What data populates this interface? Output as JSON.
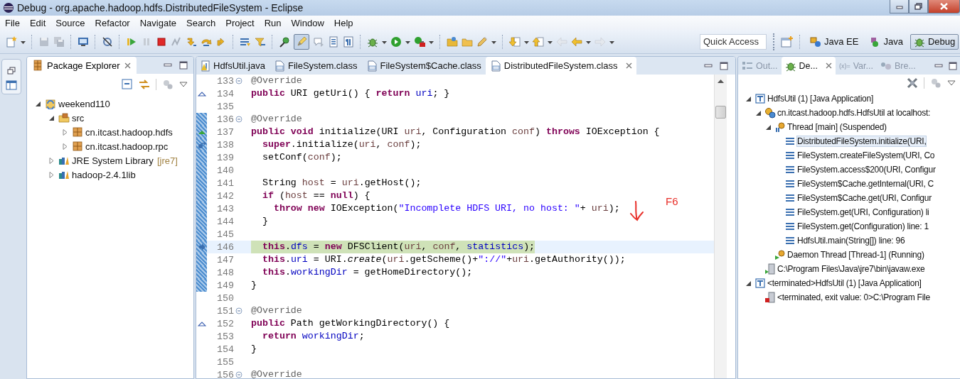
{
  "window": {
    "title": "Debug - org.apache.hadoop.hdfs.DistributedFileSystem - Eclipse"
  },
  "menu": [
    "File",
    "Edit",
    "Source",
    "Refactor",
    "Navigate",
    "Search",
    "Project",
    "Run",
    "Window",
    "Help"
  ],
  "toolbar": {
    "highlight_toggle": {
      "pressed": true
    },
    "quick_access": {
      "placeholder": "Quick Access"
    },
    "perspectives": [
      {
        "label": "Java EE",
        "selected": false
      },
      {
        "label": "Java",
        "selected": false
      },
      {
        "label": "Debug",
        "selected": true
      }
    ]
  },
  "package_explorer": {
    "title": "Package Explorer",
    "tree": [
      {
        "label": "weekend110",
        "kind": "project",
        "expanded": true,
        "children": [
          {
            "label": "src",
            "kind": "source-folder",
            "expanded": true,
            "children": [
              {
                "label": "cn.itcast.hadoop.hdfs",
                "kind": "package",
                "expanded": false
              },
              {
                "label": "cn.itcast.hadoop.rpc",
                "kind": "package",
                "expanded": false
              }
            ]
          },
          {
            "label": "JRE System Library",
            "decoration": "[jre7]",
            "kind": "library",
            "expanded": false
          },
          {
            "label": "hadoop-2.4.1lib",
            "kind": "library",
            "expanded": false
          }
        ]
      }
    ]
  },
  "editor": {
    "tabs": [
      {
        "label": "HdfsUtil.java",
        "kind": "java",
        "selected": false
      },
      {
        "label": "FileSystem.class",
        "kind": "class",
        "selected": false
      },
      {
        "label": "FileSystem$Cache.class",
        "kind": "class",
        "selected": false
      },
      {
        "label": "DistributedFileSystem.class",
        "kind": "class",
        "selected": true
      }
    ],
    "lines": [
      {
        "number": "133",
        "collapsible": true,
        "in_range": false,
        "current": false,
        "tokens": [
          {
            "kind": "ann",
            "text": "@Override"
          }
        ]
      },
      {
        "number": "134",
        "collapsible": false,
        "in_range": false,
        "current": false,
        "marker": {
          "kind": "override"
        },
        "tokens": [
          {
            "kind": "kw",
            "text": "public"
          },
          {
            "kind": "t",
            "text": " URI getUri() { "
          },
          {
            "kind": "kw",
            "text": "return "
          },
          {
            "kind": "fld",
            "text": "uri"
          },
          {
            "kind": "t",
            "text": "; }"
          }
        ]
      },
      {
        "number": "135",
        "collapsible": false,
        "in_range": false,
        "current": false
      },
      {
        "number": "136",
        "collapsible": true,
        "in_range": true,
        "current": false,
        "tokens": [
          {
            "kind": "ann",
            "text": "@Override"
          }
        ]
      },
      {
        "number": "137",
        "collapsible": false,
        "in_range": true,
        "current": false,
        "marker": {
          "kind": "implements"
        },
        "tokens": [
          {
            "kind": "kw",
            "text": "public void"
          },
          {
            "kind": "t",
            "text": " initialize(URI "
          },
          {
            "kind": "var",
            "text": "uri"
          },
          {
            "kind": "t",
            "text": ", Configuration "
          },
          {
            "kind": "var",
            "text": "conf"
          },
          {
            "kind": "t",
            "text": ") "
          },
          {
            "kind": "kw",
            "text": "throws"
          },
          {
            "kind": "t",
            "text": " IOException {"
          }
        ]
      },
      {
        "number": "138",
        "collapsible": false,
        "in_range": true,
        "current": false,
        "marker": {
          "kind": "step"
        },
        "tokens": [
          {
            "kind": "kw",
            "text": "  super"
          },
          {
            "kind": "t",
            "text": ".initialize("
          },
          {
            "kind": "var",
            "text": "uri"
          },
          {
            "kind": "t",
            "text": ", "
          },
          {
            "kind": "var",
            "text": "conf"
          },
          {
            "kind": "t",
            "text": ");"
          }
        ]
      },
      {
        "number": "139",
        "collapsible": false,
        "in_range": true,
        "current": false,
        "tokens": [
          {
            "kind": "t",
            "text": "  setConf("
          },
          {
            "kind": "var",
            "text": "conf"
          },
          {
            "kind": "t",
            "text": ");"
          }
        ]
      },
      {
        "number": "140",
        "collapsible": false,
        "in_range": true,
        "current": false
      },
      {
        "number": "141",
        "collapsible": false,
        "in_range": true,
        "current": false,
        "tokens": [
          {
            "kind": "t",
            "text": "  String "
          },
          {
            "kind": "var",
            "text": "host"
          },
          {
            "kind": "t",
            "text": " = "
          },
          {
            "kind": "var",
            "text": "uri"
          },
          {
            "kind": "t",
            "text": ".getHost();"
          }
        ]
      },
      {
        "number": "142",
        "collapsible": false,
        "in_range": true,
        "current": false,
        "tokens": [
          {
            "kind": "kw",
            "text": "  if"
          },
          {
            "kind": "t",
            "text": " ("
          },
          {
            "kind": "var",
            "text": "host"
          },
          {
            "kind": "t",
            "text": " == "
          },
          {
            "kind": "kw",
            "text": "null"
          },
          {
            "kind": "t",
            "text": ") {"
          }
        ]
      },
      {
        "number": "143",
        "collapsible": false,
        "in_range": true,
        "current": false,
        "tokens": [
          {
            "kind": "kw",
            "text": "    throw new"
          },
          {
            "kind": "t",
            "text": " IOException("
          },
          {
            "kind": "str",
            "text": "\"Incomplete HDFS URI, no host: \""
          },
          {
            "kind": "t",
            "text": "+ "
          },
          {
            "kind": "var",
            "text": "uri"
          },
          {
            "kind": "t",
            "text": ");"
          }
        ]
      },
      {
        "number": "144",
        "collapsible": false,
        "in_range": true,
        "current": false,
        "tokens": [
          {
            "kind": "t",
            "text": "  }"
          }
        ]
      },
      {
        "number": "145",
        "collapsible": false,
        "in_range": true,
        "current": false
      },
      {
        "number": "146",
        "collapsible": false,
        "in_range": true,
        "current": true,
        "tokens": [
          {
            "kind": "kw",
            "text": "  this"
          },
          {
            "kind": "t",
            "text": "."
          },
          {
            "kind": "fld",
            "text": "dfs"
          },
          {
            "kind": "t",
            "text": " = "
          },
          {
            "kind": "kw",
            "text": "new"
          },
          {
            "kind": "t",
            "text": " DFSClient("
          },
          {
            "kind": "var",
            "text": "uri"
          },
          {
            "kind": "t",
            "text": ", "
          },
          {
            "kind": "var",
            "text": "conf"
          },
          {
            "kind": "t",
            "text": ", "
          },
          {
            "kind": "fld",
            "text": "statistics"
          },
          {
            "kind": "t",
            "text": ");"
          }
        ]
      },
      {
        "number": "147",
        "collapsible": false,
        "in_range": true,
        "current": false,
        "tokens": [
          {
            "kind": "kw",
            "text": "  this"
          },
          {
            "kind": "t",
            "text": "."
          },
          {
            "kind": "fld",
            "text": "uri"
          },
          {
            "kind": "t",
            "text": " = URI."
          },
          {
            "kind": "it",
            "text": "create"
          },
          {
            "kind": "t",
            "text": "("
          },
          {
            "kind": "var",
            "text": "uri"
          },
          {
            "kind": "t",
            "text": ".getScheme()+"
          },
          {
            "kind": "str",
            "text": "\"://\""
          },
          {
            "kind": "t",
            "text": "+"
          },
          {
            "kind": "var",
            "text": "uri"
          },
          {
            "kind": "t",
            "text": ".getAuthority());"
          }
        ]
      },
      {
        "number": "148",
        "collapsible": false,
        "in_range": true,
        "current": false,
        "tokens": [
          {
            "kind": "kw",
            "text": "  this"
          },
          {
            "kind": "t",
            "text": "."
          },
          {
            "kind": "fld",
            "text": "workingDir"
          },
          {
            "kind": "t",
            "text": " = getHomeDirectory();"
          }
        ]
      },
      {
        "number": "149",
        "collapsible": false,
        "in_range": true,
        "current": false,
        "tokens": [
          {
            "kind": "t",
            "text": "}"
          }
        ]
      },
      {
        "number": "150",
        "collapsible": false,
        "in_range": false,
        "current": false
      },
      {
        "number": "151",
        "collapsible": true,
        "in_range": false,
        "current": false,
        "tokens": [
          {
            "kind": "ann",
            "text": "@Override"
          }
        ]
      },
      {
        "number": "152",
        "collapsible": false,
        "in_range": false,
        "current": false,
        "marker": {
          "kind": "override"
        },
        "tokens": [
          {
            "kind": "kw",
            "text": "public"
          },
          {
            "kind": "t",
            "text": " Path getWorkingDirectory() {"
          }
        ]
      },
      {
        "number": "153",
        "collapsible": false,
        "in_range": false,
        "current": false,
        "tokens": [
          {
            "kind": "kw",
            "text": "  return "
          },
          {
            "kind": "fld",
            "text": "workingDir"
          },
          {
            "kind": "t",
            "text": ";"
          }
        ]
      },
      {
        "number": "154",
        "collapsible": false,
        "in_range": false,
        "current": false,
        "tokens": [
          {
            "kind": "t",
            "text": "}"
          }
        ]
      },
      {
        "number": "155",
        "collapsible": false,
        "in_range": false,
        "current": false
      },
      {
        "number": "156",
        "collapsible": true,
        "in_range": false,
        "current": false,
        "tokens": [
          {
            "kind": "ann",
            "text": "@Override"
          }
        ]
      }
    ],
    "annotation": {
      "text": "F6",
      "color": "#e8302a"
    }
  },
  "debug_view": {
    "tabs": [
      {
        "label": "Out...",
        "kind": "outline",
        "selected": false
      },
      {
        "label": "De...",
        "kind": "debug",
        "selected": true
      },
      {
        "label": "Var...",
        "kind": "variables",
        "glyph": "(x)=",
        "selected": false
      },
      {
        "label": "Bre...",
        "kind": "breakpoints",
        "selected": false
      }
    ],
    "tree": [
      {
        "label": "HdfsUtil (1) [Java Application]",
        "kind": "launch",
        "expanded": true,
        "children": [
          {
            "label": "cn.itcast.hadoop.hdfs.HdfsUtil at localhost:",
            "kind": "vm",
            "expanded": true,
            "children": [
              {
                "label": "Thread [main] (Suspended)",
                "kind": "thread-suspended",
                "expanded": true,
                "children": [
                  {
                    "label": "DistributedFileSystem.initialize(URI,",
                    "kind": "frame",
                    "selected": true
                  },
                  {
                    "label": "FileSystem.createFileSystem(URI, Co",
                    "kind": "frame",
                    "selected": false
                  },
                  {
                    "label": "FileSystem.access$200(URI, Configur",
                    "kind": "frame",
                    "selected": false
                  },
                  {
                    "label": "FileSystem$Cache.getInternal(URI, C",
                    "kind": "frame",
                    "selected": false
                  },
                  {
                    "label": "FileSystem$Cache.get(URI, Configur",
                    "kind": "frame",
                    "selected": false
                  },
                  {
                    "label": "FileSystem.get(URI, Configuration) li",
                    "kind": "frame",
                    "selected": false
                  },
                  {
                    "label": "FileSystem.get(Configuration) line: 1",
                    "kind": "frame",
                    "selected": false
                  },
                  {
                    "label": "HdfsUtil.main(String[]) line: 96",
                    "kind": "frame",
                    "selected": false
                  }
                ]
              },
              {
                "label": "Daemon Thread [Thread-1] (Running)",
                "kind": "thread-running"
              }
            ]
          },
          {
            "label": "C:\\Program Files\\Java\\jre7\\bin\\javaw.exe",
            "kind": "process"
          }
        ]
      },
      {
        "label": "<terminated>HdfsUtil (1) [Java Application]",
        "kind": "launch",
        "expanded": true,
        "children": [
          {
            "label": "<terminated, exit value: 0>C:\\Program File",
            "kind": "process-terminated"
          }
        ]
      }
    ]
  }
}
